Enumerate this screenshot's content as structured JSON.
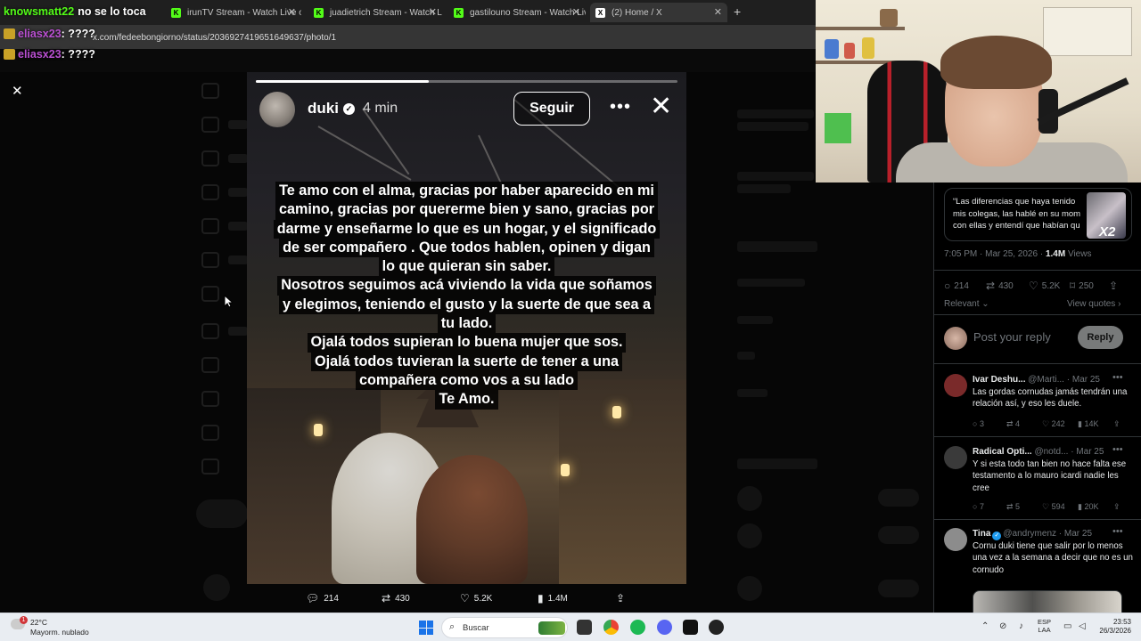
{
  "browser": {
    "tabs": [
      {
        "label": "knowsmatt22 - no se lo toca",
        "fav_color": "#53fc18",
        "fav_glyph": "K"
      },
      {
        "label": "irunTV Stream - Watch Live on",
        "fav_color": "#53fc18",
        "fav_glyph": "K"
      },
      {
        "label": "juadietrich Stream - Watch Live",
        "fav_color": "#53fc18",
        "fav_glyph": "K"
      },
      {
        "label": "gastilouno Stream - Watch Live",
        "fav_color": "#53fc18",
        "fav_glyph": "K"
      },
      {
        "label": "(2) Home / X",
        "fav_color": "#ffffff",
        "fav_glyph": "X",
        "active": true
      }
    ],
    "new_tab": "+",
    "url": "x.com/fedeebongiorno/status/2036927419651649637/photo/1"
  },
  "stream_overlay": {
    "title_user": "knowsmatt22",
    "title_suffix": "no se lo toca",
    "chat": [
      {
        "user": "eliasx23",
        "msg": ": ????"
      },
      {
        "user": "eliasx23",
        "msg": ": ????"
      }
    ]
  },
  "modal": {
    "close_glyph": "✕"
  },
  "story": {
    "username": "duki",
    "time": "4 min",
    "follow_label": "Seguir",
    "more_glyph": "•••",
    "close_glyph": "✕",
    "progress": 0.41,
    "text_lines": [
      "Te amo con el alma, gracias por haber aparecido en mi",
      "camino, gracias por quererme bien y sano, gracias por",
      "darme y enseñarme lo que es un hogar, y el significado",
      "de ser compañero . Que todos hablen, opinen y digan",
      "lo que quieran sin saber.",
      "Nosotros seguimos acá viviendo la vida  que soñamos",
      "y elegimos, teniendo el gusto y la suerte de que sea a",
      "tu lado.",
      "Ojalá todos supieran lo buena mujer que sos.",
      "Ojalá todos tuvieran la suerte de tener a una",
      "compañera como vos a su lado",
      "Te Amo."
    ]
  },
  "actions": {
    "replies": "214",
    "reposts": "430",
    "likes": "5.2K",
    "views": "1.4M"
  },
  "right_panel": {
    "quote_text": "“Las diferencias que haya tenido mis colegas, las hablé en su mom con ellas y entendí que habían qu",
    "quote_overlay": "X2",
    "timestamp": "7:05 PM · Mar 25, 2026 · ",
    "views_count": "1.4M",
    "views_label": " Views",
    "stats": {
      "replies": "214",
      "reposts": "430",
      "likes": "5.2K",
      "bookmarks": "250"
    },
    "relevant_label": "Relevant ⌄",
    "view_quotes_label": "View quotes ›",
    "reply_placeholder": "Post your reply",
    "reply_button": "Reply",
    "comments": [
      {
        "name": "Ivar Deshu...",
        "handle": "@Marti...",
        "date": "· Mar 25",
        "verified": false,
        "text": "Las gordas cornudas jamás tendrán una relación así, y eso les duele.",
        "replies": "3",
        "reposts": "4",
        "likes": "242",
        "views": "14K",
        "avatar_color": "#7a2a2a"
      },
      {
        "name": "Radical Opti...",
        "handle": "@notd...",
        "date": "· Mar 25",
        "verified": false,
        "text": "Y si esta todo tan bien no hace falta ese testamento a lo mauro icardi nadie les cree",
        "replies": "7",
        "reposts": "5",
        "likes": "594",
        "views": "20K",
        "avatar_color": "#3a3a3a"
      },
      {
        "name": "Tina",
        "handle": "@andrymenz",
        "date": "· Mar 25",
        "verified": true,
        "text": "Cornu duki tiene que salir por lo menos una vez a la semana a decir que no es un cornudo",
        "avatar_color": "#8c8c8c"
      }
    ]
  },
  "taskbar": {
    "weather_badge": "1",
    "temperature": "22°C",
    "condition": "Mayorm. nublado",
    "search_label": "Buscar",
    "lang_line1": "ESP",
    "lang_line2": "LAA",
    "time": "23:53",
    "date": "26/3/2026"
  }
}
